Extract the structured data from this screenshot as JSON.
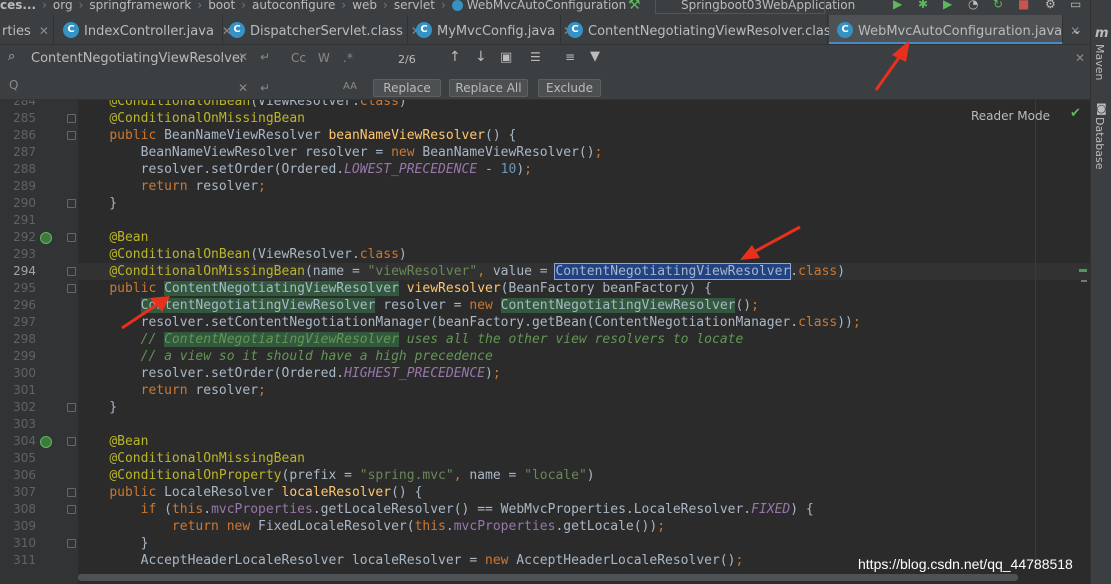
{
  "breadcrumb": [
    "ces...",
    "org",
    "springframework",
    "boot",
    "autoconfigure",
    "web",
    "servlet",
    "WebMvcAutoConfiguration"
  ],
  "run_config": "Springboot03WebApplication",
  "tabs": [
    {
      "label": "rties",
      "icon": ""
    },
    {
      "label": "IndexController.java",
      "icon": "C"
    },
    {
      "label": "DispatcherServlet.class",
      "icon": "C"
    },
    {
      "label": "MyMvcConfig.java",
      "icon": "C"
    },
    {
      "label": "ContentNegotiatingViewResolver.class",
      "icon": "C"
    },
    {
      "label": "WebMvcAutoConfiguration.java",
      "icon": "C",
      "active": true
    }
  ],
  "find": {
    "query": "ContentNegotiatingViewResolver",
    "match_count": "2/6",
    "replace_label": "Replace",
    "replace_all_label": "Replace All",
    "exclude_label": "Exclude",
    "case_toggle": "Cc",
    "word_toggle": "W",
    "regex_toggle": ".*",
    "preserve_case": "AA"
  },
  "editor": {
    "reader_mode": "Reader Mode",
    "line_numbers": [
      "284",
      "285",
      "286",
      "287",
      "288",
      "289",
      "290",
      "291",
      "292",
      "293",
      "294",
      "295",
      "296",
      "297",
      "298",
      "299",
      "300",
      "301",
      "302",
      "303",
      "304",
      "305",
      "306",
      "307",
      "308",
      "309",
      "310",
      "311"
    ],
    "current_line": "294"
  },
  "right_tools": {
    "maven": "Maven",
    "database": "Database"
  },
  "watermark": "https://blog.csdn.net/qq_44788518",
  "colors": {
    "accent": "#4a88c7",
    "arrow": "#e8301e",
    "highlight": "#32593d",
    "selection": "#214283"
  }
}
